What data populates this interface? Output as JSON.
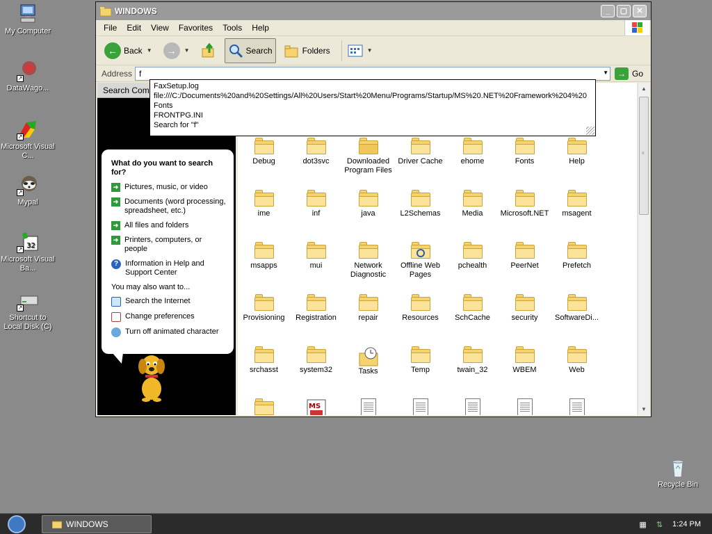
{
  "desktop": {
    "icons": [
      {
        "label": "My Computer"
      },
      {
        "label": "DataWago..."
      },
      {
        "label": "Microsoft Visual C..."
      },
      {
        "label": "Mypal"
      },
      {
        "label": "Microsoft Visual Ba..."
      },
      {
        "label": "Shortcut to Local Disk (C)"
      },
      {
        "label": "Recycle Bin"
      }
    ]
  },
  "window": {
    "title": "WINDOWS",
    "menu": [
      "File",
      "Edit",
      "View",
      "Favorites",
      "Tools",
      "Help"
    ],
    "toolbar": {
      "back": "Back",
      "search": "Search",
      "folders": "Folders"
    },
    "address": {
      "label": "Address",
      "value": "f",
      "go": "Go"
    },
    "autocomplete": [
      "FaxSetup.log",
      "file:///C:/Documents%20and%20Settings/All%20Users/Start%20Menu/Programs/Startup/MS%20.NET%20Framework%204%20",
      "Fonts",
      "FRONTPG.INI",
      "Search for \"f\""
    ]
  },
  "search_panel": {
    "header": "Search Comp",
    "question": "What do you want to search for?",
    "options": [
      "Pictures, music, or video",
      "Documents (word processing, spreadsheet, etc.)",
      "All files and folders",
      "Printers, computers, or people",
      "Information in Help and Support Center"
    ],
    "also_label": "You may also want to...",
    "also_options": [
      "Search the Internet",
      "Change preferences",
      "Turn off animated character"
    ]
  },
  "files": [
    {
      "name": "Debug",
      "type": "folder"
    },
    {
      "name": "dot3svc",
      "type": "folder"
    },
    {
      "name": "Downloaded Program Files",
      "type": "folder-special"
    },
    {
      "name": "Driver Cache",
      "type": "folder"
    },
    {
      "name": "ehome",
      "type": "folder"
    },
    {
      "name": "Fonts",
      "type": "folder"
    },
    {
      "name": "Help",
      "type": "folder"
    },
    {
      "name": "ime",
      "type": "folder"
    },
    {
      "name": "inf",
      "type": "folder"
    },
    {
      "name": "java",
      "type": "folder"
    },
    {
      "name": "L2Schemas",
      "type": "folder"
    },
    {
      "name": "Media",
      "type": "folder"
    },
    {
      "name": "Microsoft.NET",
      "type": "folder"
    },
    {
      "name": "msagent",
      "type": "folder"
    },
    {
      "name": "msapps",
      "type": "folder"
    },
    {
      "name": "mui",
      "type": "folder"
    },
    {
      "name": "Network Diagnostic",
      "type": "folder"
    },
    {
      "name": "Offline Web Pages",
      "type": "folder-sync"
    },
    {
      "name": "pchealth",
      "type": "folder"
    },
    {
      "name": "PeerNet",
      "type": "folder"
    },
    {
      "name": "Prefetch",
      "type": "folder"
    },
    {
      "name": "Provisioning",
      "type": "folder"
    },
    {
      "name": "Registration",
      "type": "folder"
    },
    {
      "name": "repair",
      "type": "folder"
    },
    {
      "name": "Resources",
      "type": "folder"
    },
    {
      "name": "SchCache",
      "type": "folder"
    },
    {
      "name": "security",
      "type": "folder"
    },
    {
      "name": "SoftwareDi...",
      "type": "folder"
    },
    {
      "name": "srchasst",
      "type": "folder"
    },
    {
      "name": "system32",
      "type": "folder"
    },
    {
      "name": "Tasks",
      "type": "tasks"
    },
    {
      "name": "Temp",
      "type": "folder"
    },
    {
      "name": "twain_32",
      "type": "folder"
    },
    {
      "name": "WBEM",
      "type": "folder"
    },
    {
      "name": "Web",
      "type": "folder"
    },
    {
      "name": "",
      "type": "folder"
    },
    {
      "name": "",
      "type": "msi"
    },
    {
      "name": "",
      "type": "doc"
    },
    {
      "name": "",
      "type": "doc"
    },
    {
      "name": "",
      "type": "img"
    },
    {
      "name": "",
      "type": "doc"
    },
    {
      "name": "",
      "type": "doc"
    }
  ],
  "taskbar": {
    "window_button": "WINDOWS",
    "time": "1:24 PM"
  },
  "colors": {
    "desktop": "#8a8a8a",
    "folder": "#f5d36e",
    "green_arrow": "#2f9a3a",
    "taskbar": "#2b2b2b"
  }
}
